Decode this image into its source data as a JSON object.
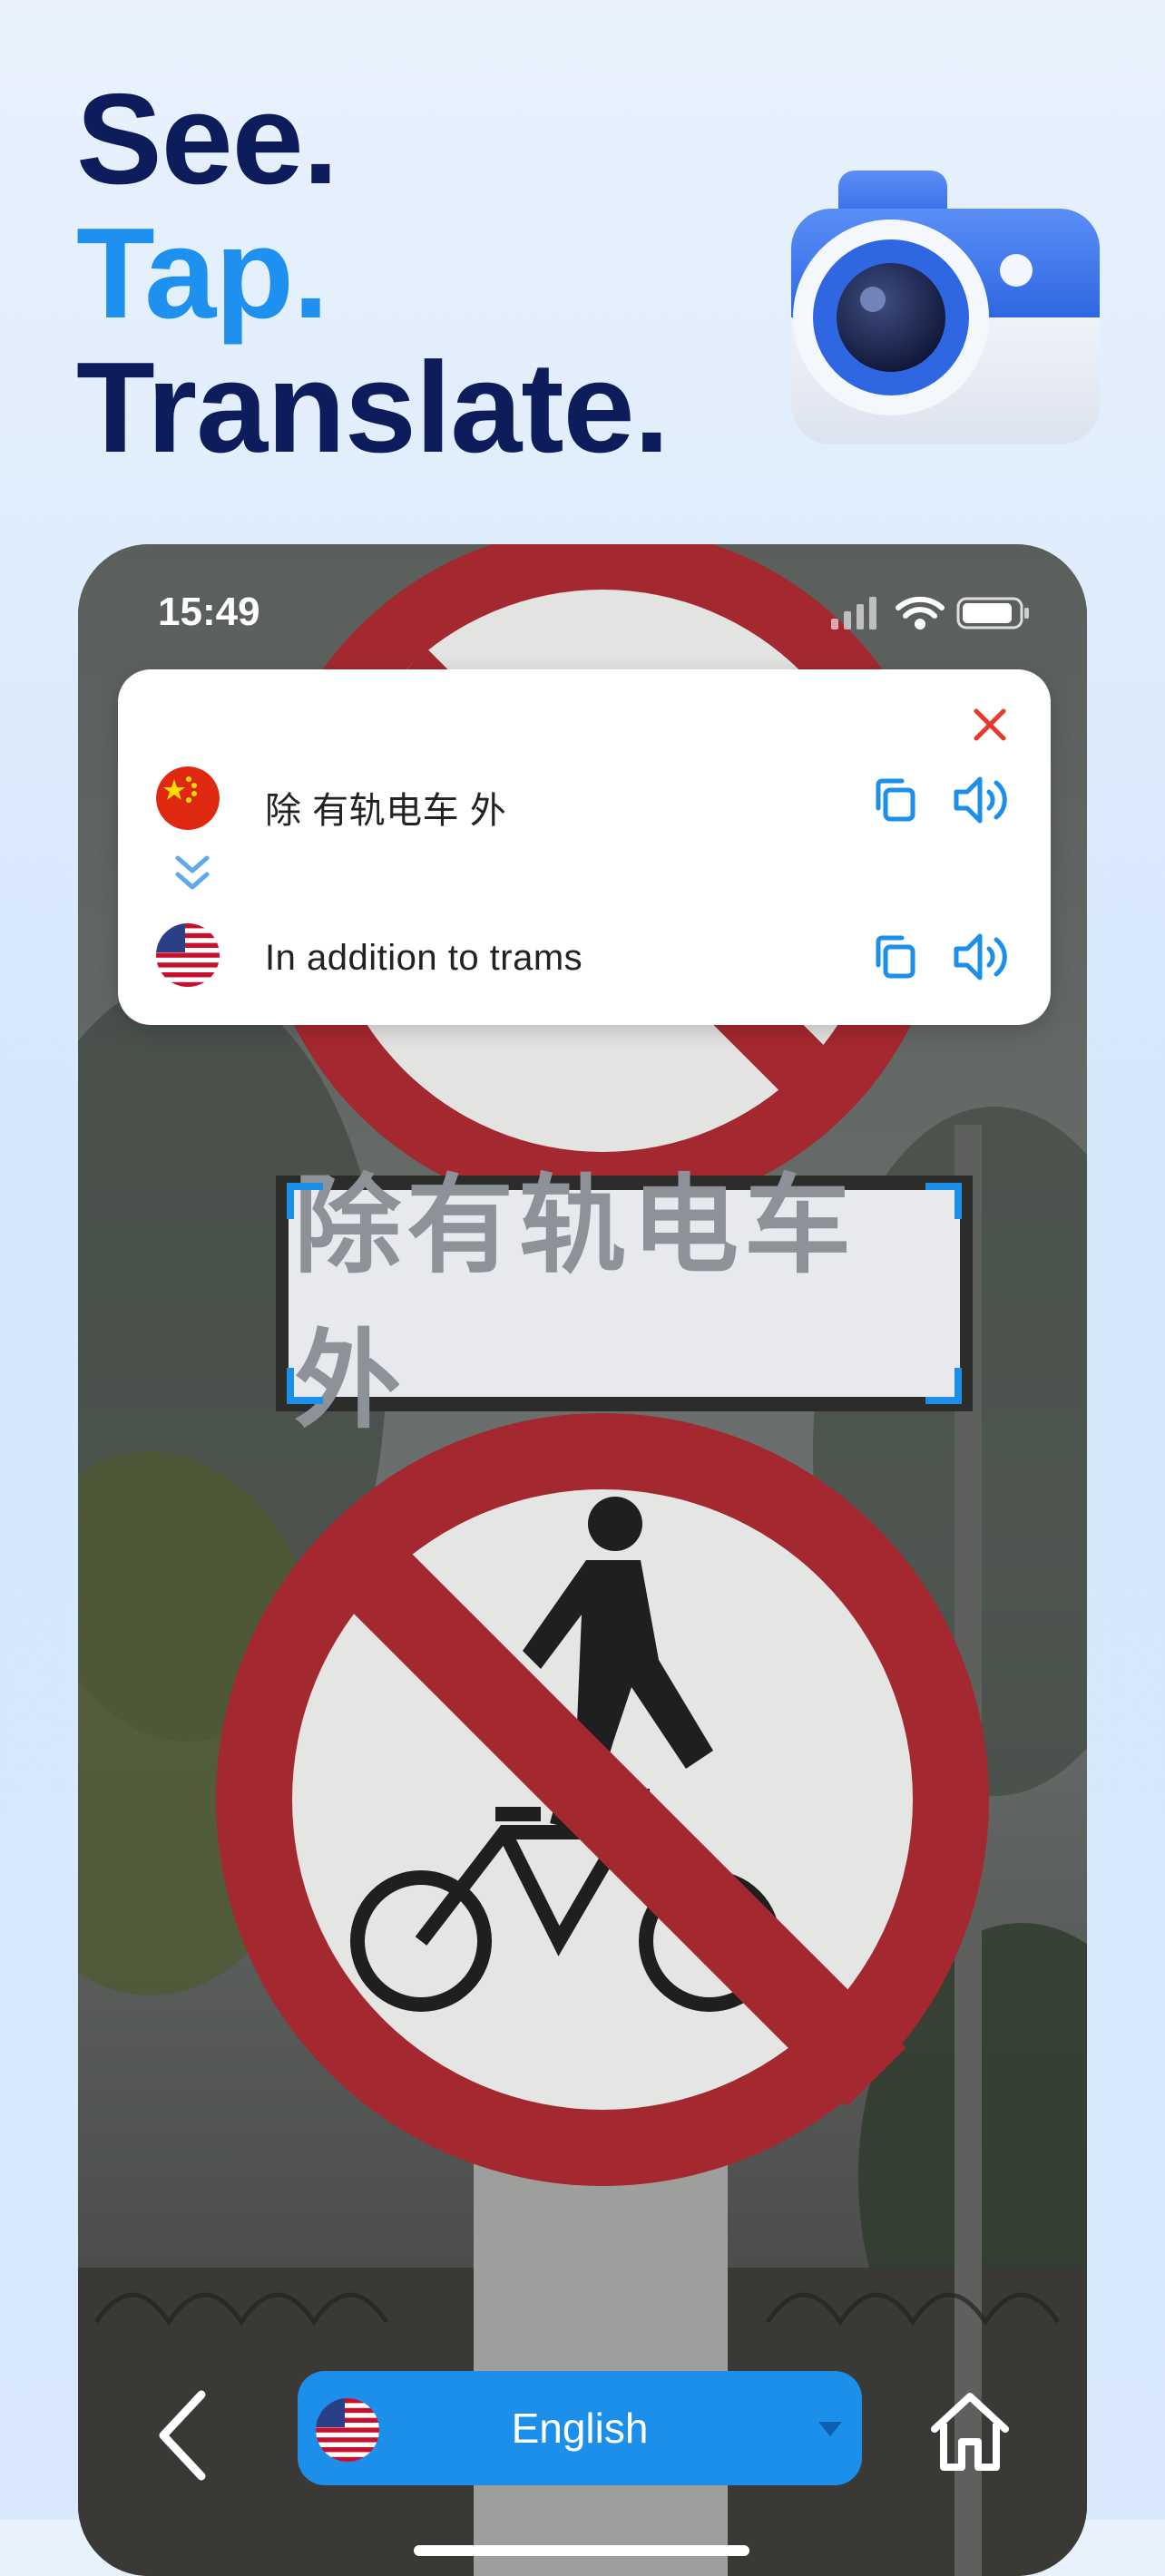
{
  "headline": {
    "line1": "See.",
    "line2": "Tap.",
    "line3": "Translate."
  },
  "status_bar": {
    "time": "15:49"
  },
  "translation_card": {
    "source_text": "除 有轨电车 外",
    "target_text": "In addition to trams",
    "icons": {
      "close": "close-icon",
      "copy": "copy-icon",
      "speaker": "speaker-icon",
      "swap": "chevron-double-down-icon",
      "source_flag": "china-flag-icon",
      "target_flag": "us-flag-icon"
    }
  },
  "scan": {
    "recognized_text": "除有轨电车外"
  },
  "bottom_bar": {
    "language": "English",
    "icons": {
      "back": "chevron-left-icon",
      "home": "home-icon",
      "dropdown": "caret-down-icon"
    }
  },
  "colors": {
    "accent": "#1b8fea",
    "headline": "#0d1d5c",
    "headline_accent": "#1e90f0",
    "close": "#e53a2c"
  }
}
